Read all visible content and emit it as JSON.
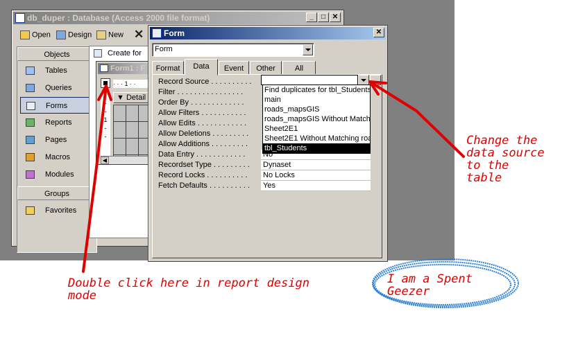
{
  "db_window": {
    "title": "db_duper : Database (Access 2000 file format)",
    "toolbar": {
      "open_label": "Open",
      "design_label": "Design",
      "new_label": "New",
      "delete_glyph": "✕"
    },
    "objects_header": "Objects",
    "objects": [
      {
        "label": "Tables",
        "icon": "table-icon"
      },
      {
        "label": "Queries",
        "icon": "query-icon"
      },
      {
        "label": "Forms",
        "icon": "form-icon",
        "selected": true
      },
      {
        "label": "Reports",
        "icon": "report-icon"
      },
      {
        "label": "Pages",
        "icon": "page-icon"
      },
      {
        "label": "Macros",
        "icon": "macro-icon"
      },
      {
        "label": "Modules",
        "icon": "module-icon"
      }
    ],
    "groups_header": "Groups",
    "groups": [
      {
        "label": "Favorites",
        "icon": "favorites-icon"
      }
    ],
    "create_text": "Create for"
  },
  "form1_window": {
    "title": "Form1 : F",
    "detail_label": "Detail",
    "ruler_text": "· · · 1 · ·"
  },
  "props_window": {
    "title": "Form",
    "object_selector_value": "Form",
    "tabs": [
      {
        "label": "Format"
      },
      {
        "label": "Data",
        "active": true
      },
      {
        "label": "Event"
      },
      {
        "label": "Other"
      },
      {
        "label": "All"
      }
    ],
    "rows": [
      {
        "label": "Record Source . . . . . . . . . .",
        "value": ""
      },
      {
        "label": "Filter . . . . . . . . . . . . . . . .",
        "value": ""
      },
      {
        "label": "Order By . . . . . . . . . . . . .",
        "value": ""
      },
      {
        "label": "Allow Filters . . . . . . . . . . .",
        "value": ""
      },
      {
        "label": "Allow Edits . . . . . . . . . . . .",
        "value": ""
      },
      {
        "label": "Allow Deletions . . . . . . . . .",
        "value": ""
      },
      {
        "label": "Allow Additions . . . . . . . . .",
        "value": ""
      },
      {
        "label": "Data Entry . . . . . . . . . . . .",
        "value": "No"
      },
      {
        "label": "Recordset Type . . . . . . . . .",
        "value": "Dynaset"
      },
      {
        "label": "Record Locks . . . . . . . . . .",
        "value": "No Locks"
      },
      {
        "label": "Fetch Defaults . . . . . . . . . .",
        "value": "Yes"
      }
    ],
    "record_source_options": [
      "Find duplicates for tbl_Students",
      "main",
      "roads_mapsGIS",
      "roads_mapsGIS Without Matching",
      "Sheet2E1",
      "Sheet2E1 Without Matching roa",
      "tbl_Students"
    ],
    "selected_option": "tbl_Students"
  },
  "annotations": {
    "change_source": "Change the\ndata source\nto the\ntable",
    "double_click": "Double click here in report design\nmode",
    "signature": "I am a Spent\nGeezer"
  },
  "colors": {
    "annotation_red": "#e00000",
    "scribble_blue": "#2a7fd6",
    "active_title": "#0a246a",
    "inactive_title": "#808080"
  }
}
